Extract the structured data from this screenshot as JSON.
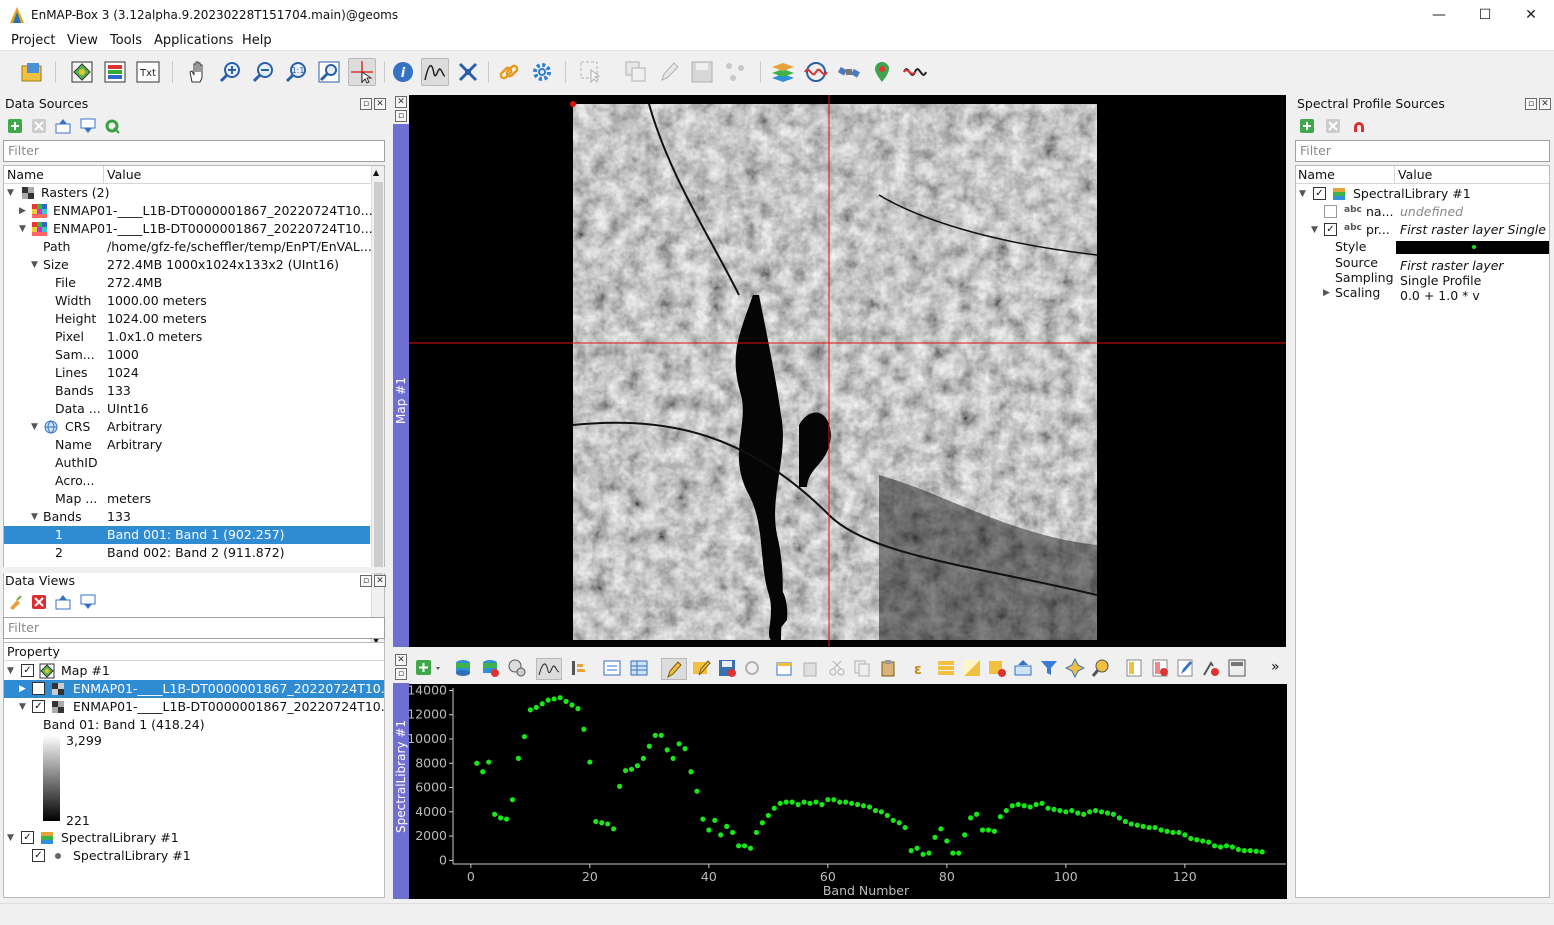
{
  "window": {
    "title": "EnMAP-Box 3 (3.12alpha.9.20230228T151704.main)@geoms",
    "minimize": "—",
    "maximize": "☐",
    "close": "✕"
  },
  "menus": [
    "Project",
    "View",
    "Tools",
    "Applications",
    "Help"
  ],
  "toolbar_icons": [
    "open-project-icon",
    "add-vector-icon",
    "add-raster-icon",
    "add-text-icon",
    "pan-icon",
    "zoom-in-icon",
    "zoom-out-icon",
    "zoom-native-icon",
    "zoom-full-icon",
    "select-crosshair-icon",
    "identify-icon",
    "spectral-profile-icon",
    "move-center-icon",
    "link-maps-icon",
    "settings-gear-icon",
    "select-features-icon",
    "copy-features-icon",
    "edit-pencil-icon",
    "save-edits-icon",
    "vertex-icon",
    "layers-stack-icon",
    "processing-icon",
    "satellite-icon",
    "location-pin-icon",
    "spectral-wave-icon"
  ],
  "data_sources": {
    "title": "Data Sources",
    "filter": "Filter",
    "col_name": "Name",
    "col_value": "Value",
    "rows": [
      {
        "name": "Rasters (2)",
        "value": ""
      },
      {
        "name": "ENMAP01-____L1B-DT0000001867_20220724T10...",
        "value": ""
      },
      {
        "name": "ENMAP01-____L1B-DT0000001867_20220724T10...",
        "value": ""
      },
      {
        "name": "Path",
        "value": "/home/gfz-fe/scheffler/temp/EnPT/EnVAL..."
      },
      {
        "name": "Size",
        "value": "272.4MB 1000x1024x133x2 (UInt16)"
      },
      {
        "name": "File",
        "value": "272.4MB"
      },
      {
        "name": "Width",
        "value": "1000.00 meters"
      },
      {
        "name": "Height",
        "value": "1024.00 meters"
      },
      {
        "name": "Pixel",
        "value": "1.0x1.0 meters"
      },
      {
        "name": "Sam...",
        "value": "1000"
      },
      {
        "name": "Lines",
        "value": "1024"
      },
      {
        "name": "Bands",
        "value": "133"
      },
      {
        "name": "Data ...",
        "value": "UInt16"
      },
      {
        "name": "CRS",
        "value": "Arbitrary"
      },
      {
        "name": "Name",
        "value": "Arbitrary"
      },
      {
        "name": "AuthID",
        "value": ""
      },
      {
        "name": "Acro...",
        "value": ""
      },
      {
        "name": "Map ...",
        "value": "meters"
      },
      {
        "name": "Bands",
        "value": "133"
      },
      {
        "name": "1",
        "value": "Band 001: Band 1 (902.257)"
      },
      {
        "name": "2",
        "value": "Band 002: Band 2 (911.872)"
      }
    ]
  },
  "data_views": {
    "title": "Data Views",
    "filter": "Filter",
    "col_property": "Property",
    "rows": [
      "Map #1",
      "ENMAP01-____L1B-DT0000001867_20220724T10...",
      "ENMAP01-____L1B-DT0000001867_20220724T10...",
      "Band 01: Band 1 (418.24)",
      "SpectralLibrary #1",
      "SpectralLibrary #1"
    ],
    "ramp_max": "3,299",
    "ramp_min": "221"
  },
  "map": {
    "tab": "Map #1"
  },
  "speclib": {
    "tab": "SpectralLibrary #1",
    "more": "»",
    "xlabel": "Band Number",
    "yticks": [
      "14000",
      "12000",
      "10000",
      "8000",
      "6000",
      "4000",
      "2000",
      "0"
    ],
    "xticks": [
      "0",
      "20",
      "40",
      "60",
      "80",
      "100",
      "120"
    ]
  },
  "sps": {
    "title": "Spectral Profile Sources",
    "filter": "Filter",
    "col_name": "Name",
    "col_value": "Value",
    "rows": [
      {
        "name": "SpectralLibrary #1",
        "value": ""
      },
      {
        "name": "na...",
        "value": "undefined"
      },
      {
        "name": "pr...",
        "value": "First raster layer Single P"
      },
      {
        "name": "Style",
        "value": ""
      },
      {
        "name": "Source",
        "value": "First raster layer"
      },
      {
        "name": "Sampling",
        "value": "Single Profile"
      },
      {
        "name": "Scaling",
        "value": "0.0 + 1.0 * v"
      }
    ],
    "abc": "abc"
  },
  "chart_data": {
    "type": "scatter",
    "xlabel": "Band Number",
    "ylabel": "",
    "xlim": [
      -3,
      137
    ],
    "ylim": [
      -300,
      14200
    ],
    "series": [
      {
        "color": "#19e619",
        "x": [
          1,
          2,
          3,
          4,
          5,
          6,
          7,
          8,
          9,
          10,
          11,
          12,
          13,
          14,
          15,
          16,
          17,
          18,
          19,
          20,
          21,
          22,
          23,
          24,
          25,
          26,
          27,
          28,
          29,
          30,
          31,
          32,
          33,
          34,
          35,
          36,
          37,
          38,
          39,
          40,
          41,
          42,
          43,
          44,
          45,
          46,
          47,
          48,
          49,
          50,
          51,
          52,
          53,
          54,
          55,
          56,
          57,
          58,
          59,
          60,
          61,
          62,
          63,
          64,
          65,
          66,
          67,
          68,
          69,
          70,
          71,
          72,
          73,
          74,
          75,
          76,
          77,
          78,
          79,
          80,
          81,
          82,
          83,
          84,
          85,
          86,
          87,
          88,
          89,
          90,
          91,
          92,
          93,
          94,
          95,
          96,
          97,
          98,
          99,
          100,
          101,
          102,
          103,
          104,
          105,
          106,
          107,
          108,
          109,
          110,
          111,
          112,
          113,
          114,
          115,
          116,
          117,
          118,
          119,
          120,
          121,
          122,
          123,
          124,
          125,
          126,
          127,
          128,
          129,
          130,
          131,
          132,
          133
        ],
        "y": [
          8000,
          7300,
          8100,
          3800,
          3500,
          3400,
          5000,
          8400,
          10200,
          12400,
          12600,
          12900,
          13200,
          13300,
          13400,
          13100,
          12800,
          12500,
          10800,
          8100,
          3200,
          3100,
          3000,
          2600,
          6100,
          7400,
          7500,
          7800,
          8400,
          9400,
          10300,
          10300,
          9100,
          8400,
          9600,
          9200,
          7300,
          5700,
          3400,
          2500,
          3300,
          2100,
          2800,
          2300,
          1200,
          1200,
          1000,
          2300,
          3100,
          3700,
          4300,
          4700,
          4800,
          4800,
          4600,
          4800,
          4700,
          4800,
          4600,
          5000,
          5000,
          4800,
          4800,
          4700,
          4600,
          4500,
          4400,
          4100,
          4000,
          3700,
          3300,
          3100,
          2700,
          800,
          1000,
          500,
          600,
          1900,
          2600,
          1600,
          600,
          600,
          2100,
          3500,
          3800,
          2500,
          2500,
          2400,
          3600,
          4100,
          4500,
          4600,
          4500,
          4400,
          4600,
          4700,
          4300,
          4200,
          4100,
          4000,
          4100,
          3900,
          3800,
          4000,
          4100,
          4000,
          3900,
          3800,
          3500,
          3200,
          3000,
          2900,
          2800,
          2700,
          2700,
          2500,
          2400,
          2300,
          2300,
          2100,
          1800,
          1700,
          1600,
          1500,
          1200,
          1100,
          1200,
          1100,
          900,
          800,
          800,
          750,
          700
        ]
      }
    ]
  }
}
